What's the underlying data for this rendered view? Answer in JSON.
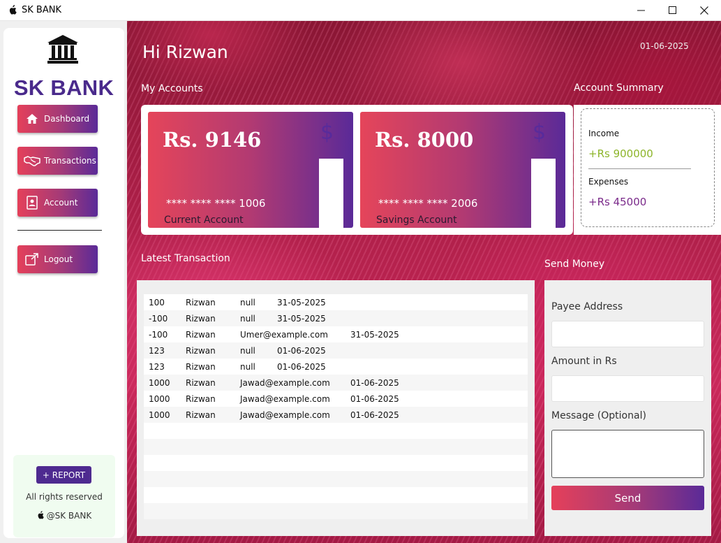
{
  "window": {
    "title": "SK BANK",
    "app_icon": "apple-icon"
  },
  "sidebar": {
    "bank_name": "SK BANK",
    "logo_icon": "bank-icon",
    "nav": [
      {
        "label": "Dashboard",
        "icon": "home-icon"
      },
      {
        "label": "Transactions",
        "icon": "handshake-icon"
      },
      {
        "label": "Account",
        "icon": "user-card-icon"
      },
      {
        "label": "Logout",
        "icon": "external-link-icon"
      }
    ],
    "report_label": "+ REPORT",
    "rights": "All rights reserved",
    "copyright": "@SK BANK"
  },
  "header": {
    "greeting": "Hi Rizwan",
    "date": "01-06-2025"
  },
  "accounts": {
    "title": "My Accounts",
    "cards": [
      {
        "amount": "Rs. 9146",
        "number": "**** **** ****  1006",
        "type": "Current Account"
      },
      {
        "amount": "Rs. 8000",
        "number": "**** **** ****  2006",
        "type": "Savings Account"
      }
    ]
  },
  "summary": {
    "title": "Account Summary",
    "income_label": "Income",
    "income_value": "+Rs 900000",
    "expenses_label": "Expenses",
    "expenses_value": "+Rs 45000",
    "colors": {
      "income": "#8db52a",
      "expenses": "#7a2a8a"
    }
  },
  "transactions": {
    "title": "Latest Transaction",
    "rows": [
      {
        "amount": "100",
        "name": "Rizwan",
        "to": "null",
        "date": "31-05-2025"
      },
      {
        "amount": "-100",
        "name": "Rizwan",
        "to": "null",
        "date": "31-05-2025"
      },
      {
        "amount": "-100",
        "name": "Rizwan",
        "to": "Umer@example.com",
        "date": "31-05-2025"
      },
      {
        "amount": "123",
        "name": "Rizwan",
        "to": "null",
        "date": "01-06-2025"
      },
      {
        "amount": "123",
        "name": "Rizwan",
        "to": "null",
        "date": "01-06-2025"
      },
      {
        "amount": "1000",
        "name": "Rizwan",
        "to": "Jawad@example.com",
        "date": "01-06-2025"
      },
      {
        "amount": "1000",
        "name": "Rizwan",
        "to": "Jawad@example.com",
        "date": "01-06-2025"
      },
      {
        "amount": "1000",
        "name": "Rizwan",
        "to": "Jawad@example.com",
        "date": "01-06-2025"
      }
    ]
  },
  "send": {
    "title": "Send Money",
    "payee_label": "Payee Address",
    "payee_value": "",
    "amount_label": "Amount in Rs",
    "amount_value": "",
    "message_label": "Message (Optional)",
    "message_value": "",
    "button_label": "Send"
  },
  "colors": {
    "brand_purple": "#4a2a8c",
    "gradient_start": "#e5405a",
    "gradient_end": "#5a2a98"
  }
}
